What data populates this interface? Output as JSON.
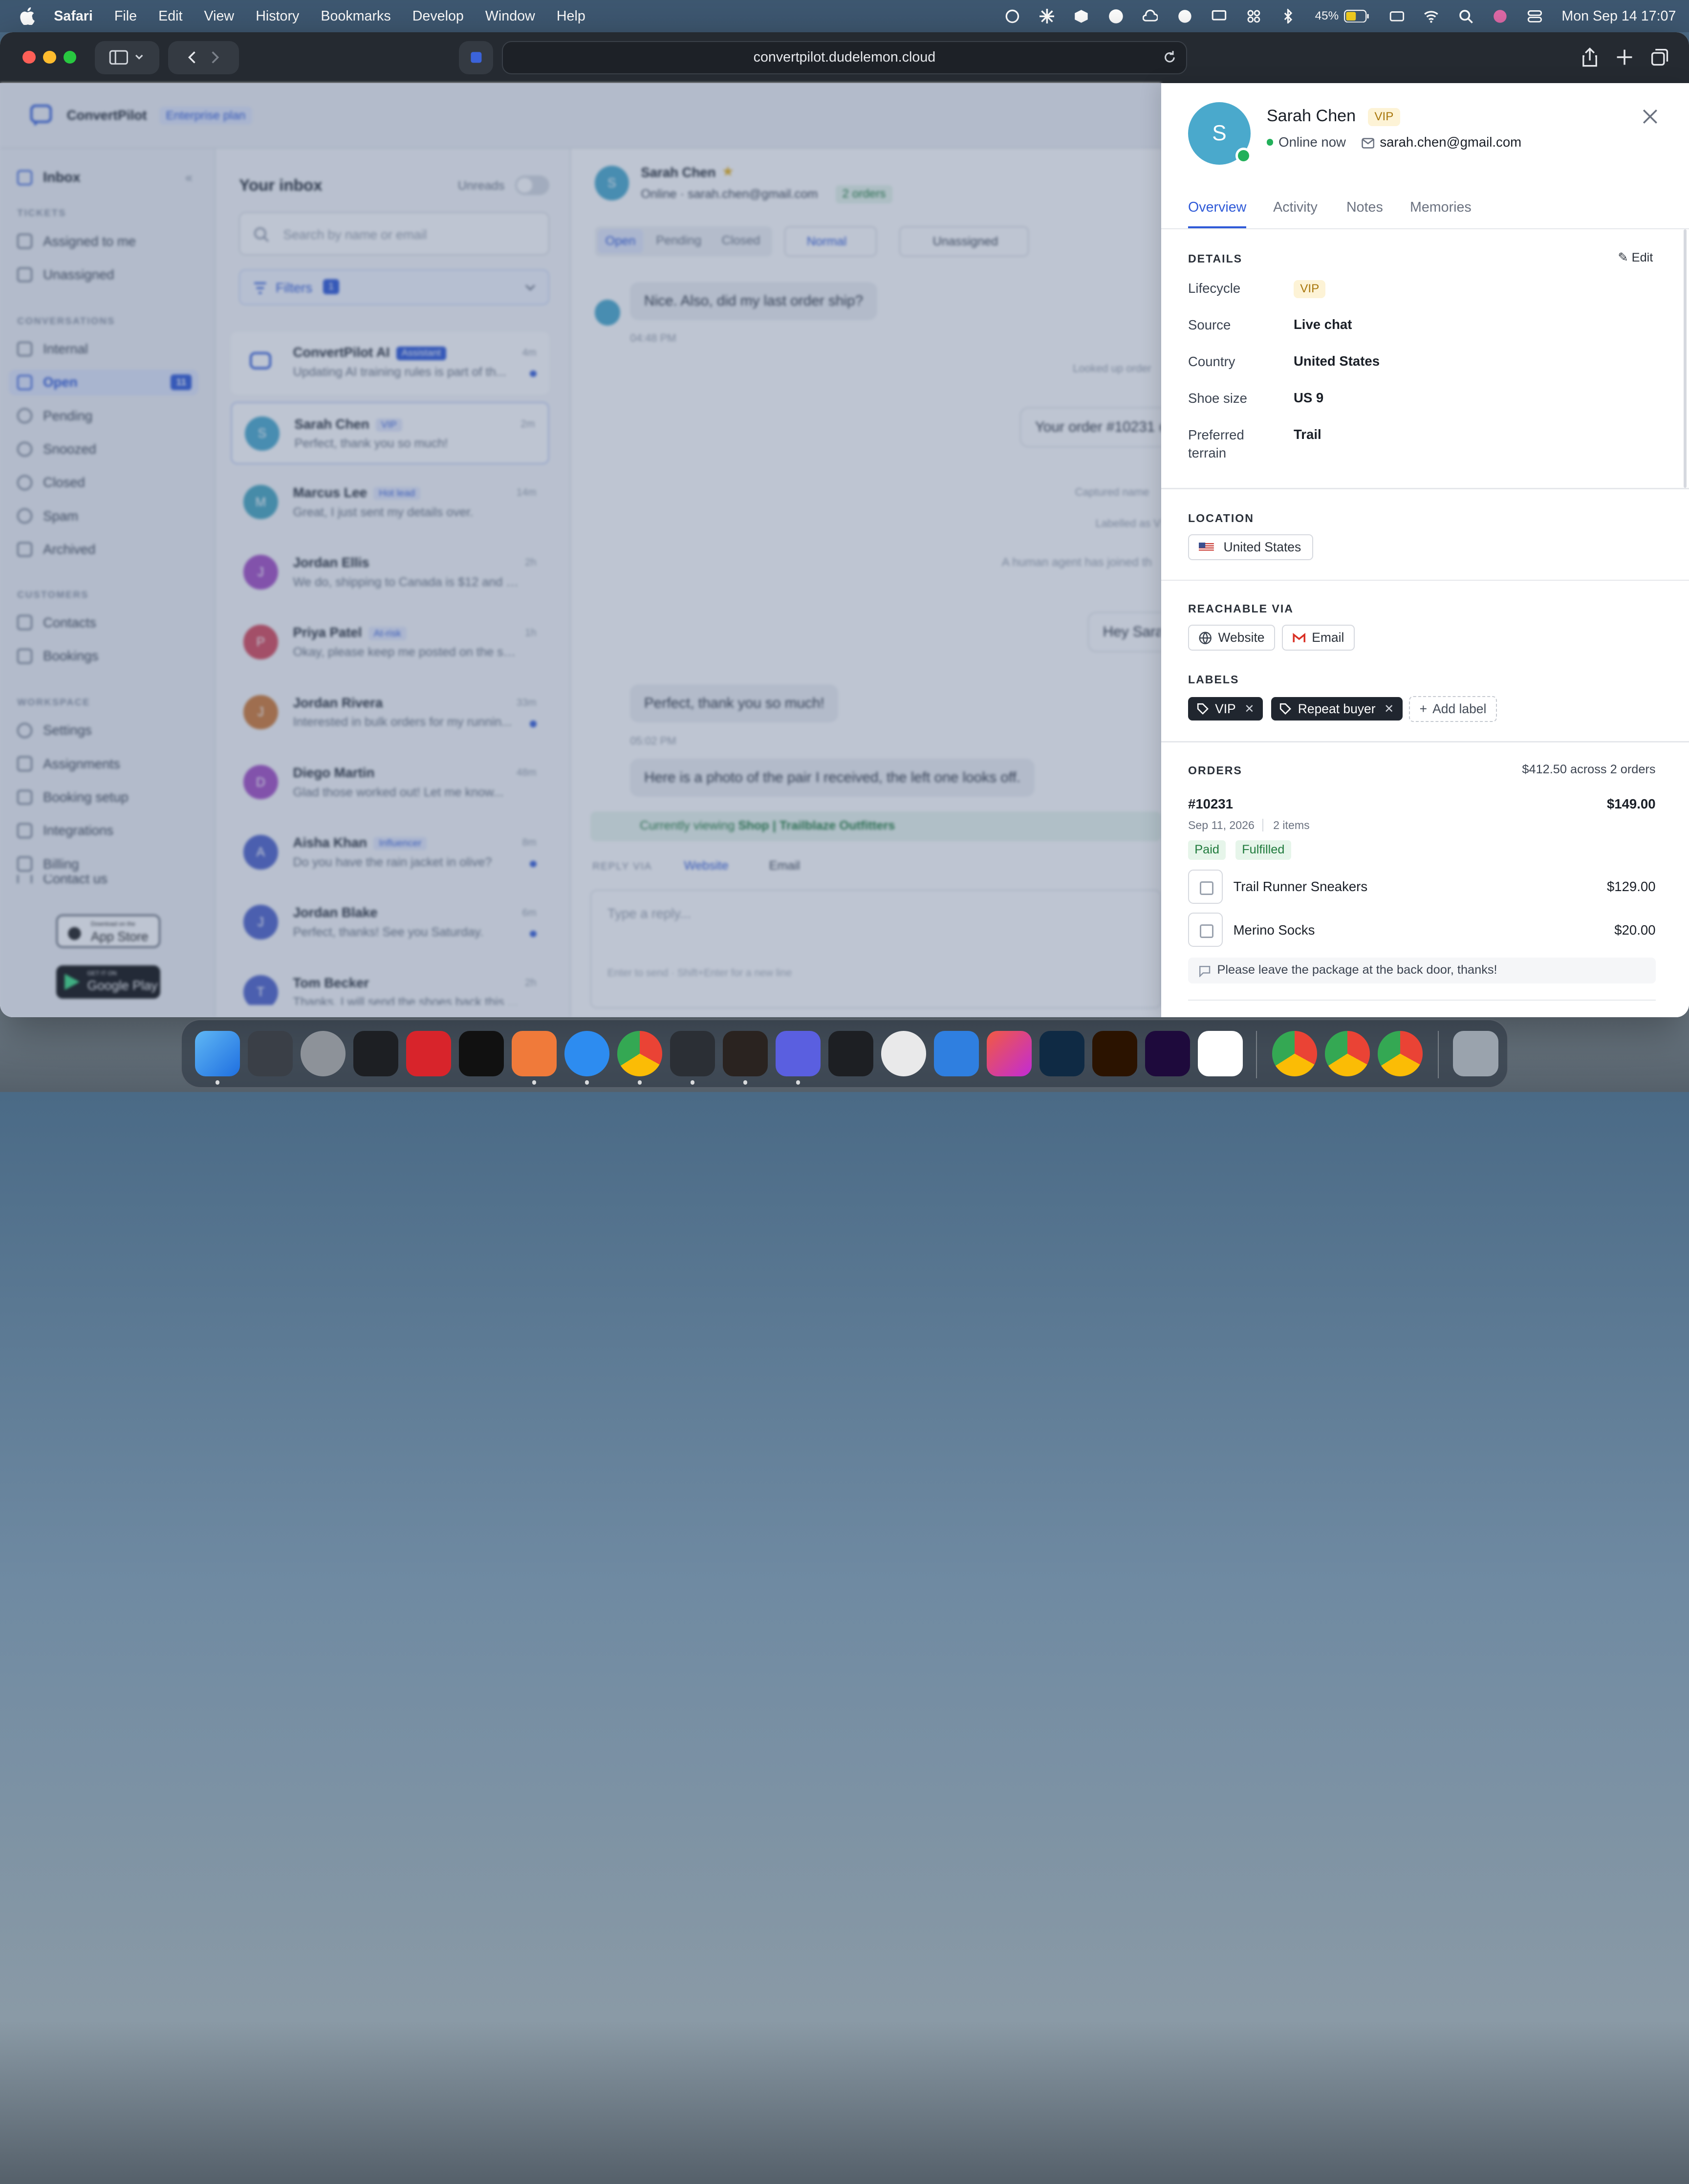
{
  "menubar": {
    "app": "Safari",
    "items": [
      "File",
      "Edit",
      "View",
      "History",
      "Bookmarks",
      "Develop",
      "Window",
      "Help"
    ],
    "battery": "45%",
    "datetime": "Mon Sep 14  17:07"
  },
  "browser": {
    "url": "convertpilot.dudelemon.cloud"
  },
  "brand": {
    "name": "ConvertPilot",
    "plan": "Enterprise plan"
  },
  "sidebar": {
    "title": "Inbox",
    "sections": {
      "tickets": "TICKETS",
      "conversations": "CONVERSATIONS",
      "customers": "CUSTOMERS",
      "workspace": "WORKSPACE"
    },
    "items": {
      "assigned": "Assigned to me",
      "unassigned": "Unassigned",
      "internal": "Internal",
      "open": "Open",
      "open_count": "11",
      "pending": "Pending",
      "snoozed": "Snoozed",
      "closed": "Closed",
      "spam": "Spam",
      "archived": "Archived",
      "contacts": "Contacts",
      "bookings": "Bookings",
      "settings": "Settings",
      "assignments": "Assignments",
      "booking_setup": "Booking setup",
      "integrations": "Integrations",
      "billing": "Billing",
      "contact_us": "Contact us"
    },
    "app_store": "App Store",
    "app_store_top": "Download on the",
    "google_play": "Google Play",
    "google_play_top": "GET IT ON"
  },
  "inbox": {
    "title": "Your inbox",
    "unreads": "Unreads",
    "search_placeholder": "Search by name or email",
    "filters": "Filters",
    "filters_count": "1",
    "conversations": [
      {
        "name": "ConvertPilot AI",
        "tag": "Assistant",
        "preview": "Updating AI training rules is part of th...",
        "time": "4m"
      },
      {
        "name": "Sarah Chen",
        "tag": "VIP",
        "preview": "Perfect, thank you so much!",
        "time": "2m",
        "initial": "S"
      },
      {
        "name": "Marcus Lee",
        "tag": "Hot lead",
        "preview": "Great, I just sent my details over.",
        "time": "14m",
        "initial": "M"
      },
      {
        "name": "Jordan Ellis",
        "tag": "",
        "preview": "We do, shipping to Canada is $12 and u...",
        "time": "2h",
        "initial": "J"
      },
      {
        "name": "Priya Patel",
        "tag": "At-risk",
        "preview": "Okay, please keep me posted on the shi...",
        "time": "1h",
        "initial": "P"
      },
      {
        "name": "Jordan Rivera",
        "tag": "",
        "preview": "Interested in bulk orders for my runnin...",
        "time": "33m",
        "initial": "J"
      },
      {
        "name": "Diego Martin",
        "tag": "",
        "preview": "Glad those worked out! Let me know...",
        "time": "48m",
        "initial": "D"
      },
      {
        "name": "Aisha Khan",
        "tag": "Influencer",
        "preview": "Do you have the rain jacket in olive?",
        "time": "8m",
        "initial": "A"
      },
      {
        "name": "Jordan Blake",
        "tag": "",
        "preview": "Perfect, thanks! See you Saturday.",
        "time": "6m",
        "initial": "J"
      },
      {
        "name": "Tom Becker",
        "tag": "",
        "preview": "Thanks, I will send the shoes back this ...",
        "time": "2h",
        "initial": "T"
      }
    ]
  },
  "chat": {
    "name": "Sarah Chen",
    "status": "Online · sarah.chen@gmail.com",
    "orders": "2 orders",
    "initial": "S",
    "status_tabs": [
      "Open",
      "Pending",
      "Closed"
    ],
    "priority": "Normal",
    "assignee": "Unassigned",
    "messages": {
      "m1": "Nice. Also, did my last order ship?",
      "t1": "04:48 PM",
      "looked": "Looked up order",
      "m2": "Your order #10231 (",
      "captured": "Captured name",
      "labelled": "Labelled as V",
      "joined": "A human agent has joined th",
      "m3": "Hey Sara",
      "m4": "Perfect, thank you so much!",
      "t4": "05:02 PM",
      "m5": "Here is a photo of the pair I received, the left one looks off."
    },
    "viewing_prefix": "Currently viewing",
    "viewing": "Shop | Trailblaze Outfitters",
    "reply_via": "REPLY VIA",
    "website": "Website",
    "email": "Email",
    "reply_placeholder": "Type a reply...",
    "hint": "Enter to send · Shift+Enter for a new line"
  },
  "drawer": {
    "name": "Sarah Chen",
    "badge": "VIP",
    "initial": "S",
    "online": "Online now",
    "email": "sarah.chen@gmail.com",
    "tabs": [
      "Overview",
      "Activity",
      "Notes",
      "Memories"
    ],
    "details_title": "DETAILS",
    "edit": "Edit",
    "details": {
      "lifecycle_k": "Lifecycle",
      "lifecycle_v": "VIP",
      "source_k": "Source",
      "source_v": "Live chat",
      "country_k": "Country",
      "country_v": "United States",
      "shoe_k": "Shoe size",
      "shoe_v": "US 9",
      "terrain_k1": "Preferred",
      "terrain_k2": "terrain",
      "terrain_v": "Trail"
    },
    "location_title": "LOCATION",
    "location": "United States",
    "reach_title": "REACHABLE VIA",
    "reach": [
      "Website",
      "Email"
    ],
    "labels_title": "LABELS",
    "labels": [
      "VIP",
      "Repeat buyer"
    ],
    "add_label": "Add label",
    "orders_title": "ORDERS",
    "orders_summary": "$412.50 across 2 orders",
    "order": {
      "id": "#10231",
      "total": "$149.00",
      "date": "Sep 11, 2026",
      "items_count": "2 items",
      "status": [
        "Paid",
        "Fulfilled"
      ],
      "items": [
        {
          "name": "Trail Runner Sneakers",
          "price": "$129.00"
        },
        {
          "name": "Merino Socks",
          "price": "$20.00"
        }
      ],
      "note": "Please leave the package at the back door, thanks!"
    }
  },
  "colors": {
    "accent": "#2f5ad8",
    "online": "#22b05a",
    "vip_bg": "#fdf3d6",
    "vip_fg": "#a8760b",
    "label_bg": "#20262f"
  }
}
